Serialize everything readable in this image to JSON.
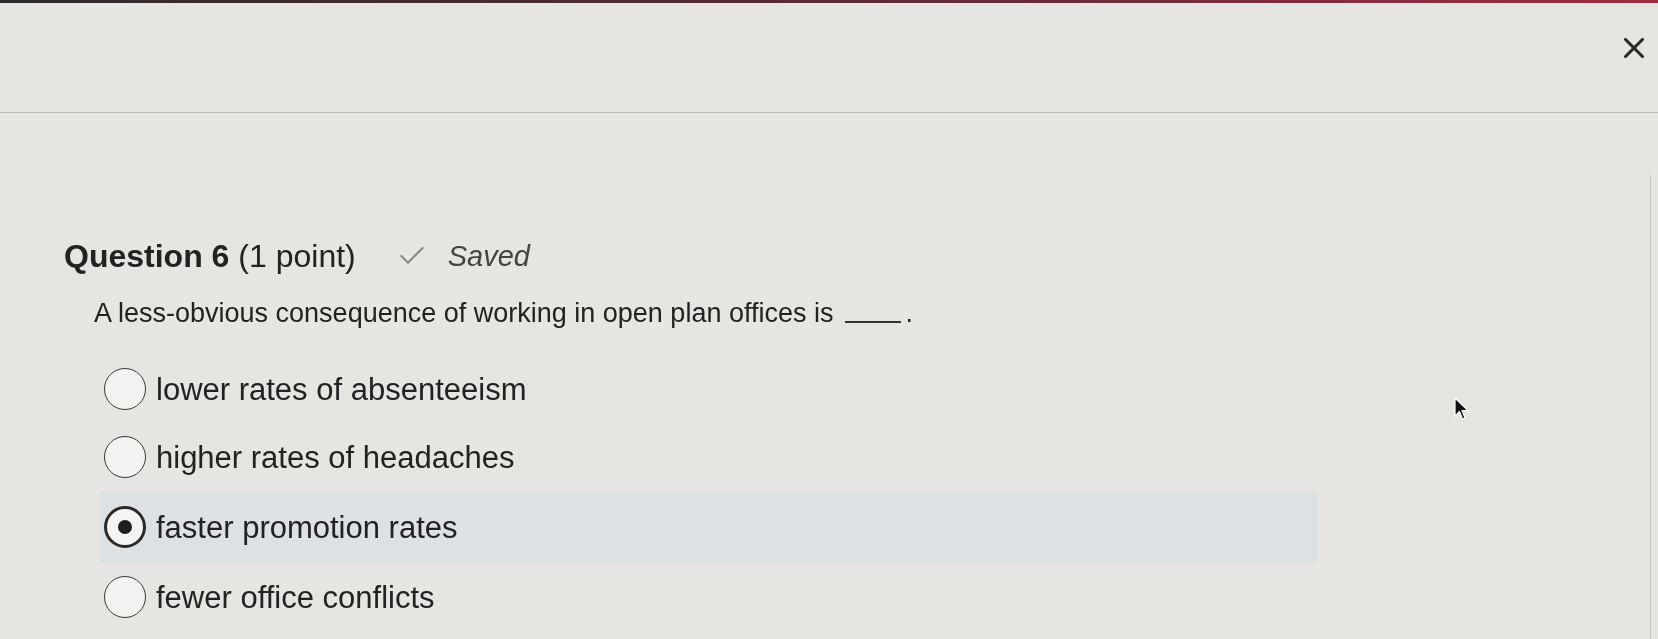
{
  "question": {
    "title": "Question 6",
    "points": "(1 point)",
    "status": {
      "kind": "saved",
      "label": "Saved"
    },
    "prompt": "A less-obvious consequence of working in open plan offices is",
    "prompt_end": "."
  },
  "options": [
    {
      "label": "lower rates of absenteeism",
      "selected": false
    },
    {
      "label": "higher rates of headaches",
      "selected": false
    },
    {
      "label": "faster promotion rates",
      "selected": true
    },
    {
      "label": "fewer office conflicts",
      "selected": false
    }
  ]
}
